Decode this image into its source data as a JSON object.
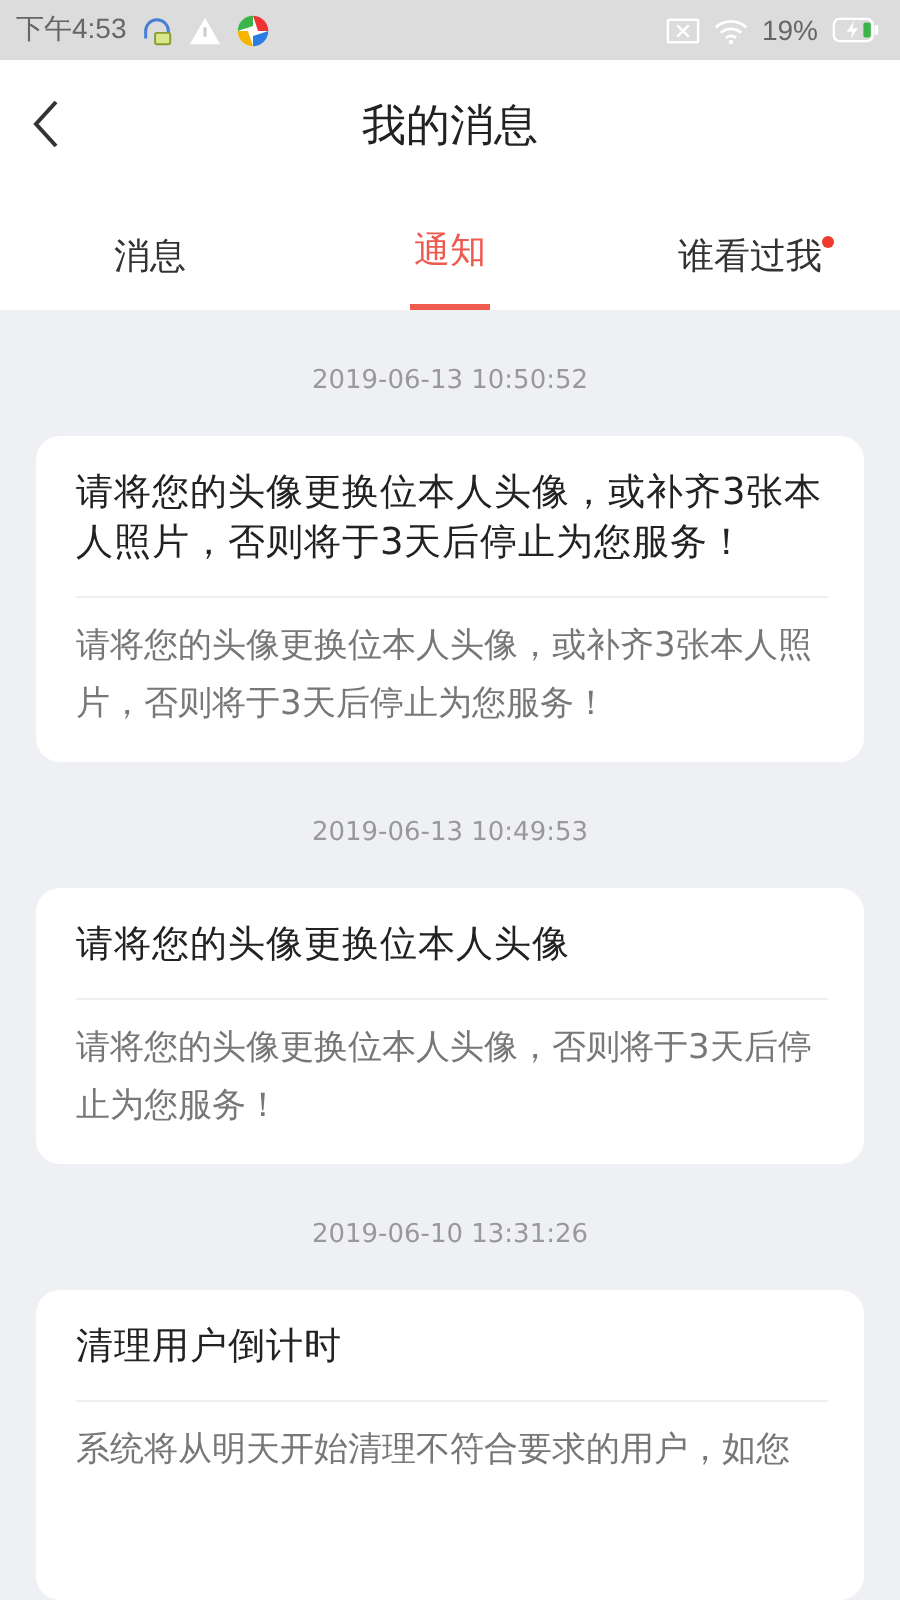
{
  "status_bar": {
    "time": "下午4:53",
    "battery": "19%"
  },
  "header": {
    "title": "我的消息"
  },
  "tabs": [
    {
      "label": "消息",
      "selected": false,
      "badge": false
    },
    {
      "label": "通知",
      "selected": true,
      "badge": false
    },
    {
      "label": "谁看过我",
      "selected": false,
      "badge": true
    }
  ],
  "notifications": [
    {
      "time": "2019-06-13 10:50:52",
      "title": "请将您的头像更换位本人头像，或补齐3张本人照片，否则将于3天后停止为您服务！",
      "body": "请将您的头像更换位本人头像，或补齐3张本人照片，否则将于3天后停止为您服务！"
    },
    {
      "time": "2019-06-13 10:49:53",
      "title": "请将您的头像更换位本人头像",
      "body": "请将您的头像更换位本人头像，否则将于3天后停止为您服务！"
    },
    {
      "time": "2019-06-10 13:31:26",
      "title": "清理用户倒计时",
      "body": "系统将从明天开始清理不符合要求的用户，如您"
    }
  ]
}
